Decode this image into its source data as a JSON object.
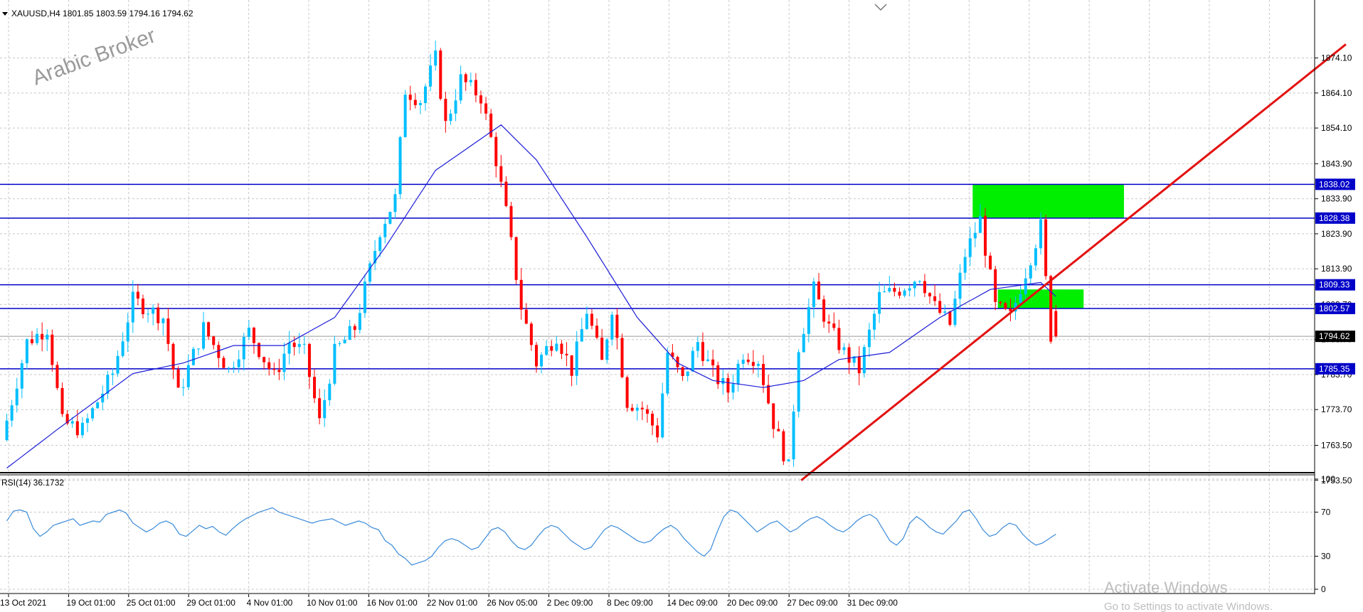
{
  "header": {
    "symbol_line": "XAUUSD,H4  1801.85 1803.59 1794.16 1794.62"
  },
  "watermark": "Arabic Broker",
  "rsi_label": "RSI(14) 36.1732",
  "activation": {
    "title": "Activate Windows",
    "subtitle": "Go to Settings to activate Windows."
  },
  "colors": {
    "candle": "#ff0000",
    "candle_alt": "#00bfff",
    "ma": "#1c1cd8",
    "level": "#0000c8",
    "trend": "#e31111",
    "zone": "#00ee00",
    "rsi": "#3b8bd9",
    "grid": "#c8c8c8"
  },
  "chart_data": [
    {
      "type": "candlestick",
      "symbol": "XAUUSD",
      "timeframe": "H4",
      "ohlc_last": {
        "open": 1801.85,
        "high": 1803.59,
        "low": 1794.16,
        "close": 1794.62
      },
      "y_ticks": [
        "1874.10",
        "1864.10",
        "1854.10",
        "1843.90",
        "1833.90",
        "1823.90",
        "1813.90",
        "1803.70",
        "1793.70",
        "1783.70",
        "1773.70",
        "1763.50",
        "1753.50"
      ],
      "y_tick_values": [
        1874.1,
        1864.1,
        1854.1,
        1843.9,
        1833.9,
        1823.9,
        1813.9,
        1803.7,
        1793.7,
        1783.7,
        1773.7,
        1763.5,
        1753.5
      ],
      "ylim": [
        1750,
        1880
      ],
      "x_ticks": [
        "13 Oct 2021",
        "19 Oct 01:00",
        "25 Oct 01:00",
        "29 Oct 01:00",
        "4 Nov 01:00",
        "10 Nov 01:00",
        "16 Nov 01:00",
        "22 Nov 01:00",
        "26 Nov 05:00",
        "2 Dec 09:00",
        "8 Dec 09:00",
        "14 Dec 09:00",
        "20 Dec 09:00",
        "27 Dec 09:00",
        "31 Dec 09:00"
      ],
      "horizontal_levels": [
        1838.02,
        1828.38,
        1809.33,
        1802.57,
        1785.35
      ],
      "level_labels": [
        "1838.02",
        "1828.38",
        "1809.33",
        "1802.57",
        "1785.35"
      ],
      "current_price_label": "1794.62",
      "price_path_anchors": [
        [
          0,
          1765
        ],
        [
          5,
          1793
        ],
        [
          9,
          1797
        ],
        [
          12,
          1770
        ],
        [
          16,
          1768
        ],
        [
          22,
          1784
        ],
        [
          26,
          1805
        ],
        [
          32,
          1800
        ],
        [
          35,
          1778
        ],
        [
          40,
          1797
        ],
        [
          45,
          1785
        ],
        [
          49,
          1796
        ],
        [
          54,
          1783
        ],
        [
          57,
          1793
        ],
        [
          60,
          1790
        ],
        [
          63,
          1770
        ],
        [
          66,
          1790
        ],
        [
          70,
          1797
        ],
        [
          75,
          1825
        ],
        [
          78,
          1834
        ],
        [
          80,
          1865
        ],
        [
          83,
          1862
        ],
        [
          86,
          1874
        ],
        [
          88,
          1855
        ],
        [
          91,
          1868
        ],
        [
          95,
          1863
        ],
        [
          98,
          1845
        ],
        [
          100,
          1830
        ],
        [
          103,
          1803
        ],
        [
          106,
          1787
        ],
        [
          110,
          1795
        ],
        [
          113,
          1785
        ],
        [
          116,
          1802
        ],
        [
          119,
          1787
        ],
        [
          121,
          1803
        ],
        [
          124,
          1776
        ],
        [
          127,
          1774
        ],
        [
          130,
          1767
        ],
        [
          132,
          1790
        ],
        [
          135,
          1782
        ],
        [
          138,
          1793
        ],
        [
          141,
          1784
        ],
        [
          144,
          1779
        ],
        [
          147,
          1790
        ],
        [
          150,
          1788
        ],
        [
          153,
          1770
        ],
        [
          156,
          1757
        ],
        [
          158,
          1792
        ],
        [
          161,
          1808
        ],
        [
          164,
          1797
        ],
        [
          167,
          1790
        ],
        [
          170,
          1785
        ],
        [
          174,
          1806
        ],
        [
          178,
          1808
        ],
        [
          182,
          1812
        ],
        [
          185,
          1803
        ],
        [
          188,
          1798
        ],
        [
          191,
          1818
        ],
        [
          194,
          1828
        ],
        [
          197,
          1803
        ],
        [
          200,
          1800
        ],
        [
          203,
          1813
        ],
        [
          206,
          1826
        ],
        [
          208,
          1795
        ]
      ],
      "moving_average_anchors": [
        [
          0,
          1757
        ],
        [
          10,
          1768
        ],
        [
          25,
          1784
        ],
        [
          35,
          1787
        ],
        [
          45,
          1792
        ],
        [
          55,
          1792
        ],
        [
          65,
          1800
        ],
        [
          75,
          1820
        ],
        [
          85,
          1842
        ],
        [
          98,
          1855
        ],
        [
          105,
          1845
        ],
        [
          115,
          1823
        ],
        [
          125,
          1800
        ],
        [
          133,
          1787
        ],
        [
          140,
          1782
        ],
        [
          150,
          1780
        ],
        [
          158,
          1782
        ],
        [
          165,
          1788
        ],
        [
          175,
          1790
        ],
        [
          185,
          1800
        ],
        [
          195,
          1808
        ],
        [
          205,
          1810
        ],
        [
          208,
          1806
        ]
      ],
      "trendline": {
        "from": {
          "index": 158,
          "price": 1753.5
        },
        "to": {
          "index": 266,
          "price": 1878
        }
      },
      "zones": [
        {
          "from_index": 192,
          "to_index": 222,
          "low": 1828.38,
          "high": 1838.02
        },
        {
          "from_index": 197,
          "to_index": 214,
          "low": 1802.57,
          "high": 1808.0
        }
      ],
      "bar_count": 209
    },
    {
      "type": "line",
      "indicator": "RSI(14)",
      "last_value": 36.1732,
      "y_ticks": [
        "100",
        "70",
        "30",
        "0"
      ],
      "y_tick_values": [
        100,
        70,
        30,
        0
      ],
      "ylim": [
        0,
        100
      ],
      "values": [
        62,
        71,
        72,
        70,
        55,
        48,
        52,
        58,
        60,
        62,
        64,
        58,
        60,
        62,
        61,
        68,
        70,
        72,
        69,
        60,
        56,
        52,
        55,
        60,
        62,
        59,
        50,
        48,
        53,
        58,
        55,
        57,
        52,
        49,
        55,
        60,
        64,
        67,
        70,
        72,
        74,
        70,
        68,
        66,
        64,
        62,
        60,
        62,
        63,
        64,
        61,
        58,
        60,
        62,
        60,
        56,
        54,
        44,
        40,
        32,
        28,
        22,
        24,
        26,
        30,
        38,
        44,
        46,
        44,
        40,
        36,
        38,
        46,
        54,
        56,
        52,
        44,
        38,
        36,
        40,
        48,
        55,
        58,
        56,
        50,
        44,
        40,
        36,
        38,
        46,
        54,
        58,
        56,
        52,
        48,
        44,
        42,
        44,
        50,
        55,
        58,
        54,
        46,
        40,
        34,
        30,
        36,
        52,
        66,
        72,
        70,
        64,
        58,
        52,
        56,
        60,
        62,
        57,
        52,
        55,
        60,
        64,
        66,
        63,
        58,
        54,
        52,
        56,
        62,
        66,
        68,
        64,
        54,
        44,
        40,
        46,
        60,
        66,
        62,
        56,
        52,
        50,
        56,
        62,
        70,
        72,
        64,
        54,
        48,
        50,
        56,
        60,
        58,
        50,
        44,
        40,
        42,
        46,
        50
      ]
    }
  ]
}
